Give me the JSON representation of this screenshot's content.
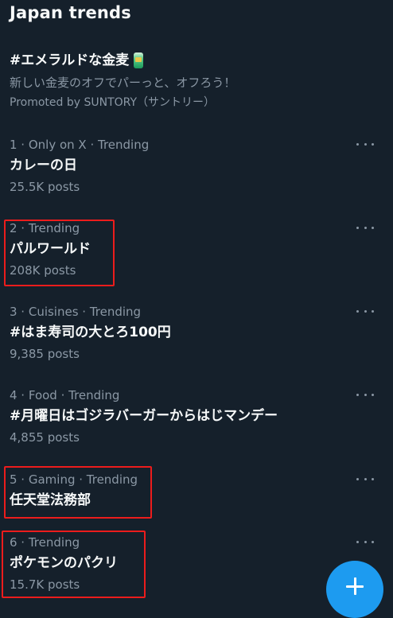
{
  "header": {
    "title": "Japan trends"
  },
  "promoted": {
    "title": "#エメラルドな金麦",
    "icon": "beer-can-icon",
    "description": "新しい金麦のオフでパーっと、オフろう！",
    "byline": "Promoted by SUNTORY（サントリー）"
  },
  "trends": [
    {
      "meta": "1 · Only on X · Trending",
      "name": "カレーの日",
      "posts": "25.5K posts",
      "highlighted": false
    },
    {
      "meta": "2 · Trending",
      "name": "パルワールド",
      "posts": "208K posts",
      "highlighted": true
    },
    {
      "meta": "3 · Cuisines · Trending",
      "name": "#はま寿司の大とろ100円",
      "posts": "9,385 posts",
      "highlighted": false
    },
    {
      "meta": "4 · Food · Trending",
      "name": "#月曜日はゴジラバーガーからはじマンデー",
      "posts": "4,855 posts",
      "highlighted": false
    },
    {
      "meta": "5 · Gaming · Trending",
      "name": "任天堂法務部",
      "posts": "",
      "highlighted": true
    },
    {
      "meta": "6 · Trending",
      "name": "ポケモンのパクリ",
      "posts": "15.7K posts",
      "highlighted": true
    }
  ],
  "icons": {
    "more": "more-dots-icon",
    "compose": "plus-icon"
  },
  "colors": {
    "background": "#15202b",
    "text": "#f7f9f9",
    "secondary_text": "#8b98a5",
    "accent": "#1d9bf0",
    "highlight_box": "#ec1c1c"
  }
}
